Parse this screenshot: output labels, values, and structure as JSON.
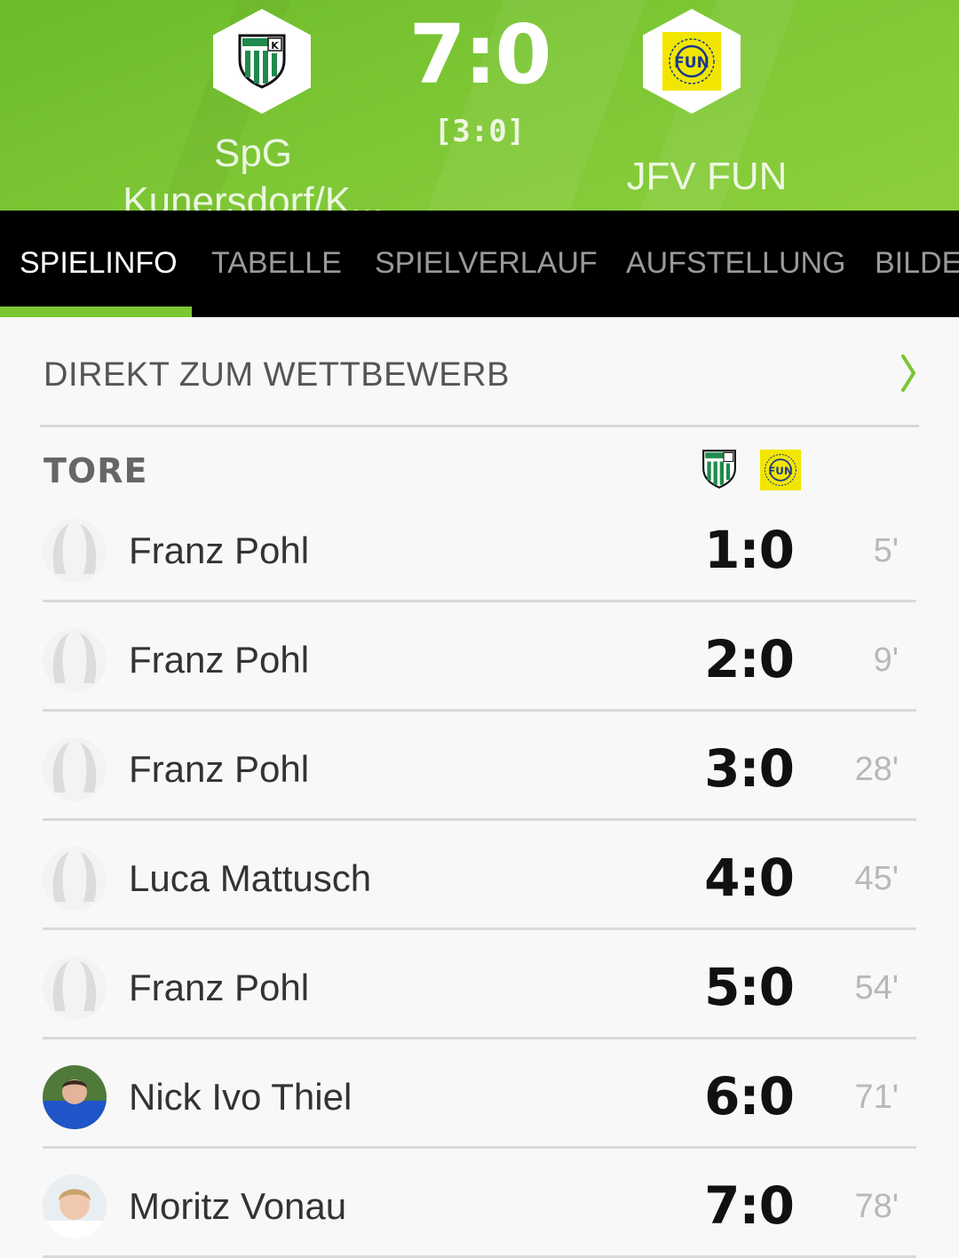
{
  "match": {
    "home_team": "SpG\nKunersdorf/K...",
    "away_team": "JFV FUN",
    "score": "7:0",
    "halftime": "[3:0]"
  },
  "tabs": [
    {
      "label": "SPIELINFO",
      "active": true
    },
    {
      "label": "TABELLE",
      "active": false
    },
    {
      "label": "SPIELVERLAUF",
      "active": false
    },
    {
      "label": "AUFSTELLUNG",
      "active": false
    },
    {
      "label": "BILDE",
      "active": false
    }
  ],
  "competition_link": "DIREKT ZUM WETTBEWERB",
  "goals_section": {
    "title": "TORE",
    "goals": [
      {
        "player": "Franz Pohl",
        "score": "1:0",
        "minute": "5'",
        "avatar": "placeholder"
      },
      {
        "player": "Franz Pohl",
        "score": "2:0",
        "minute": "9'",
        "avatar": "placeholder"
      },
      {
        "player": "Franz Pohl",
        "score": "3:0",
        "minute": "28'",
        "avatar": "placeholder"
      },
      {
        "player": "Luca Mattusch",
        "score": "4:0",
        "minute": "45'",
        "avatar": "placeholder"
      },
      {
        "player": "Franz Pohl",
        "score": "5:0",
        "minute": "54'",
        "avatar": "placeholder"
      },
      {
        "player": "Nick Ivo Thiel",
        "score": "6:0",
        "minute": "71'",
        "avatar": "photo"
      },
      {
        "player": "Moritz Vonau",
        "score": "7:0",
        "minute": "78'",
        "avatar": "photo"
      }
    ]
  },
  "colors": {
    "accent": "#7cc634",
    "tab_bar": "#000000",
    "away_logo_yellow": "#f2e600",
    "home_logo_green": "#1f8a4c"
  },
  "icons": {
    "home_logo": "shield-logo-icon",
    "away_logo": "fun-logo-icon",
    "chevron": "chevron-right-icon",
    "avatar_placeholder": "person-placeholder-icon"
  }
}
